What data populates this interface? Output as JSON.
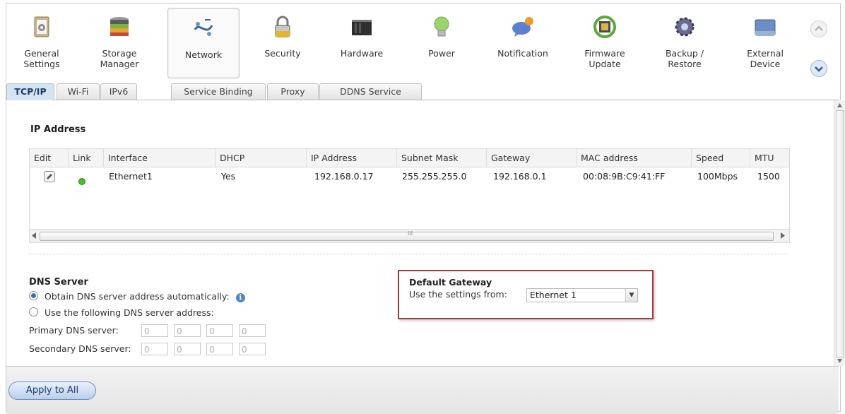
{
  "toolbar": {
    "items": [
      {
        "label": "General\nSettings",
        "icon": "general-settings-icon"
      },
      {
        "label": "Storage\nManager",
        "icon": "storage-manager-icon"
      },
      {
        "label": "Network",
        "icon": "network-icon"
      },
      {
        "label": "Security",
        "icon": "security-lock-icon"
      },
      {
        "label": "Hardware",
        "icon": "hardware-icon"
      },
      {
        "label": "Power",
        "icon": "power-bulb-icon"
      },
      {
        "label": "Notification",
        "icon": "notification-icon"
      },
      {
        "label": "Firmware\nUpdate",
        "icon": "firmware-update-icon"
      },
      {
        "label": "Backup /\nRestore",
        "icon": "backup-restore-icon"
      },
      {
        "label": "External\nDevice",
        "icon": "external-device-icon"
      }
    ],
    "active": "Network"
  },
  "tabs": [
    "TCP/IP",
    "Wi-Fi",
    "IPv6",
    "Service Binding",
    "Proxy",
    "DDNS Service"
  ],
  "ip_section": {
    "title": "IP Address",
    "columns": [
      "Edit",
      "Link",
      "Interface",
      "DHCP",
      "IP Address",
      "Subnet Mask",
      "Gateway",
      "MAC address",
      "Speed",
      "MTU"
    ],
    "rows": [
      {
        "interface": "Ethernet1",
        "dhcp": "Yes",
        "ip": "192.168.0.17",
        "subnet": "255.255.255.0",
        "gateway": "192.168.0.1",
        "mac": "00:08:9B:C9:41:FF",
        "speed": "100Mbps",
        "mtu": "1500"
      }
    ],
    "scroll_grip": "III"
  },
  "dns": {
    "title": "DNS Server",
    "option_auto": "Obtain DNS server address automatically:",
    "option_manual": "Use the following DNS server address:",
    "primary_label": "Primary DNS server:",
    "secondary_label": "Secondary DNS server:",
    "primary": [
      "0",
      "0",
      "0",
      "0"
    ],
    "secondary": [
      "0",
      "0",
      "0",
      "0"
    ]
  },
  "default_gateway": {
    "title": "Default Gateway",
    "label": "Use the settings from:",
    "value": "Ethernet 1"
  },
  "footer": {
    "apply_label": "Apply to All"
  }
}
